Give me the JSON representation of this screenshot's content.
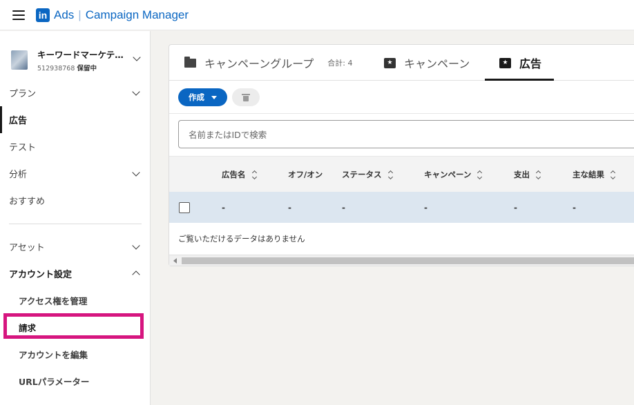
{
  "header": {
    "logo_text": "in",
    "brand_ads": "Ads",
    "brand_sep": "|",
    "brand_name": "Campaign Manager"
  },
  "account": {
    "name": "キーワードマーケテ…",
    "id": "512938768",
    "status": "保留中"
  },
  "sidebar": {
    "items": [
      {
        "label": "プラン"
      },
      {
        "label": "広告"
      },
      {
        "label": "テスト"
      },
      {
        "label": "分析"
      },
      {
        "label": "おすすめ"
      },
      {
        "label": "アセット"
      },
      {
        "label": "アカウント設定"
      },
      {
        "label": "アクセス権を管理"
      },
      {
        "label": "請求"
      },
      {
        "label": "アカウントを編集"
      },
      {
        "label": "URLパラメーター"
      }
    ]
  },
  "tabs": {
    "campaign_group": "キャンペーングループ",
    "campaign_group_count": "合計: 4",
    "campaign": "キャンペーン",
    "ads": "広告"
  },
  "toolbar": {
    "create_label": "作成"
  },
  "search": {
    "placeholder": "名前またはIDで検索"
  },
  "table": {
    "columns": [
      "広告名",
      "オフ/オン",
      "ステータス",
      "キャンペーン",
      "支出",
      "主な結果"
    ],
    "row": [
      "-",
      "-",
      "-",
      "-",
      "-",
      "-"
    ],
    "empty_message": "ご覧いただけるデータはありません"
  },
  "colors": {
    "brand": "#0a66c2",
    "highlight": "#d6157f",
    "row_selected": "#dce6f0"
  }
}
